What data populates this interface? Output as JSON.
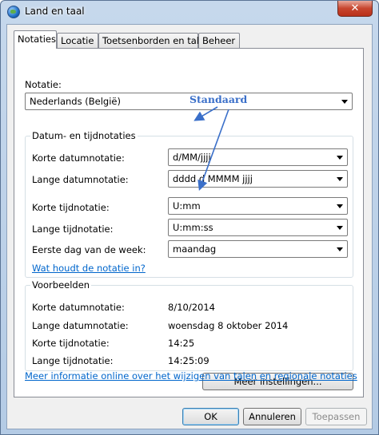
{
  "window": {
    "title": "Land en taal",
    "close_glyph": "✕"
  },
  "tabs": [
    {
      "label": "Notaties",
      "active": true
    },
    {
      "label": "Locatie"
    },
    {
      "label": "Toetsenborden en talen"
    },
    {
      "label": "Beheer"
    }
  ],
  "format": {
    "label": "Notatie:",
    "value": "Nederlands (België)"
  },
  "datetime": {
    "legend": "Datum- en tijdnotaties",
    "rows": [
      {
        "label": "Korte datumnotatie:",
        "value": "d/MM/jjjj"
      },
      {
        "label": "Lange datumnotatie:",
        "value": "dddd d MMMM jjjj"
      },
      {
        "label": "Korte tijdnotatie:",
        "value": "U:mm"
      },
      {
        "label": "Lange tijdnotatie:",
        "value": "U:mm:ss"
      },
      {
        "label": "Eerste dag van de week:",
        "value": "maandag"
      }
    ],
    "link": "Wat houdt de notatie in?"
  },
  "examples": {
    "legend": "Voorbeelden",
    "rows": [
      {
        "label": "Korte datumnotatie:",
        "value": "8/10/2014"
      },
      {
        "label": "Lange datumnotatie:",
        "value": "woensdag 8 oktober 2014"
      },
      {
        "label": "Korte tijdnotatie:",
        "value": "14:25"
      },
      {
        "label": "Lange tijdnotatie:",
        "value": "14:25:09"
      }
    ]
  },
  "more_settings_button": "Meer instellingen...",
  "info_link": "Meer informatie online over het wijzigen van talen en regionale notaties",
  "buttons": {
    "ok": "OK",
    "cancel": "Annuleren",
    "apply": "Toepassen"
  },
  "annotation": {
    "text": "Standaard",
    "color": "#3a6fc9"
  },
  "colors": {
    "link": "#0066cc",
    "close": "#c7462f"
  }
}
